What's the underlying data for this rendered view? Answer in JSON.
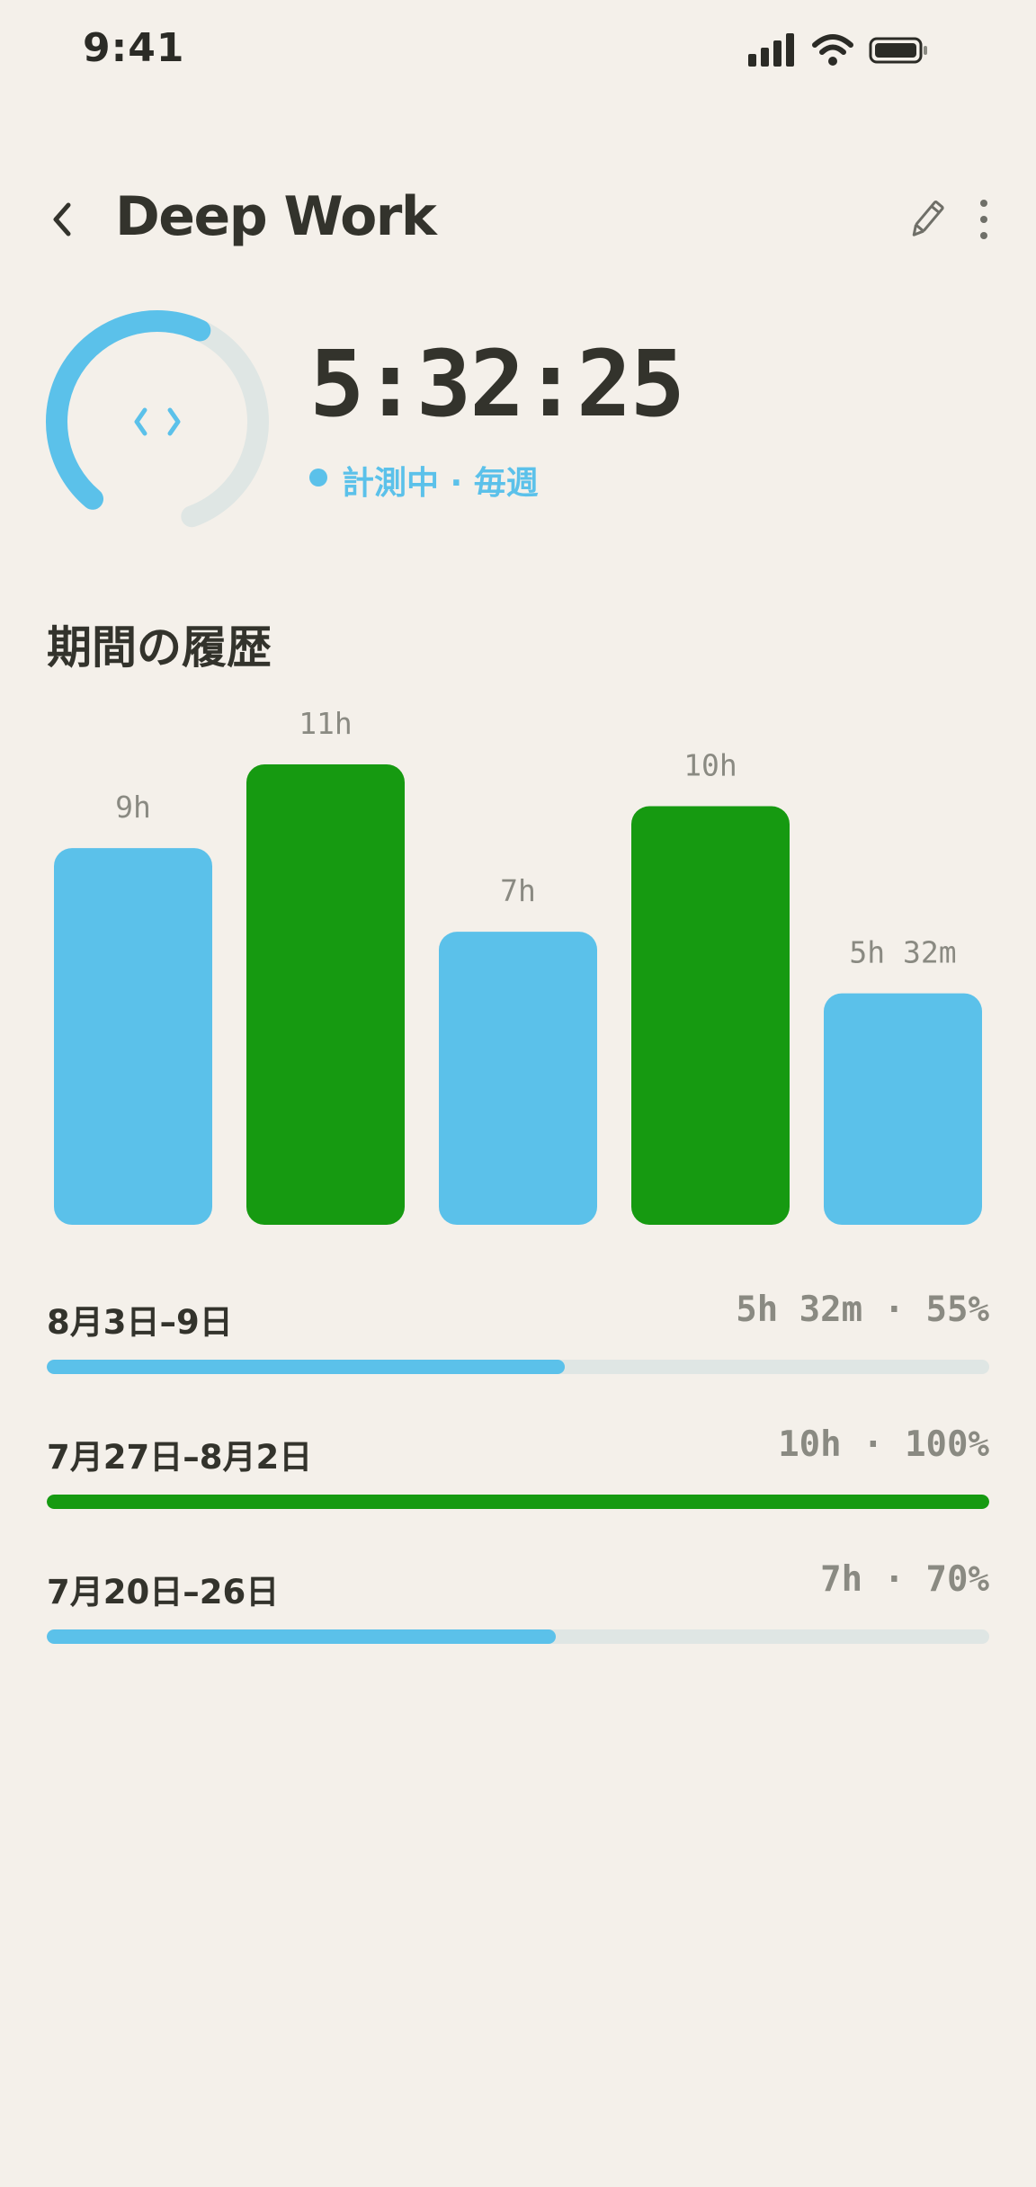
{
  "status_bar": {
    "time": "9:41",
    "icons": [
      "signal-icon",
      "wifi-icon",
      "battery-icon"
    ]
  },
  "header": {
    "title": "Deep Work",
    "back_icon": "chevron-left-icon",
    "edit_icon": "pencil-icon",
    "more_icon": "more-vertical-icon"
  },
  "timer": {
    "elapsed": "5:32:25",
    "status": "計測中 · 毎週",
    "ring_icon": "code-icon",
    "progress": 0.55
  },
  "history": {
    "title": "期間の履歴"
  },
  "chart_data": {
    "type": "bar",
    "categories": [
      "",
      "",
      "",
      "",
      ""
    ],
    "values": [
      9,
      11,
      7,
      10,
      5.53
    ],
    "labels": [
      "9h",
      "11h",
      "7h",
      "10h",
      "5h 32m"
    ],
    "colors": [
      "#5bc1ea",
      "#169a11",
      "#5bc1ea",
      "#169a11",
      "#5bc1ea"
    ],
    "title": "",
    "xlabel": "",
    "ylabel": "",
    "ylim": [
      0,
      11
    ],
    "grid": false
  },
  "periods": [
    {
      "label": "8月3日–9日",
      "value": "5h 32m · 55%",
      "progress": 0.55,
      "color": "#5bc1ea"
    },
    {
      "label": "7月27日–8月2日",
      "value": "10h · 100%",
      "progress": 1.0,
      "color": "#169a11"
    },
    {
      "label": "7月20日–26日",
      "value": "7h · 70%",
      "progress": 0.54,
      "color": "#5bc1ea"
    }
  ],
  "colors": {
    "background": "#f4f0ea",
    "accent": "#5bc1ea",
    "goal_met": "#169a11",
    "track": "#dfe6e4",
    "text": "#33332c",
    "muted": "#8a8a82"
  }
}
